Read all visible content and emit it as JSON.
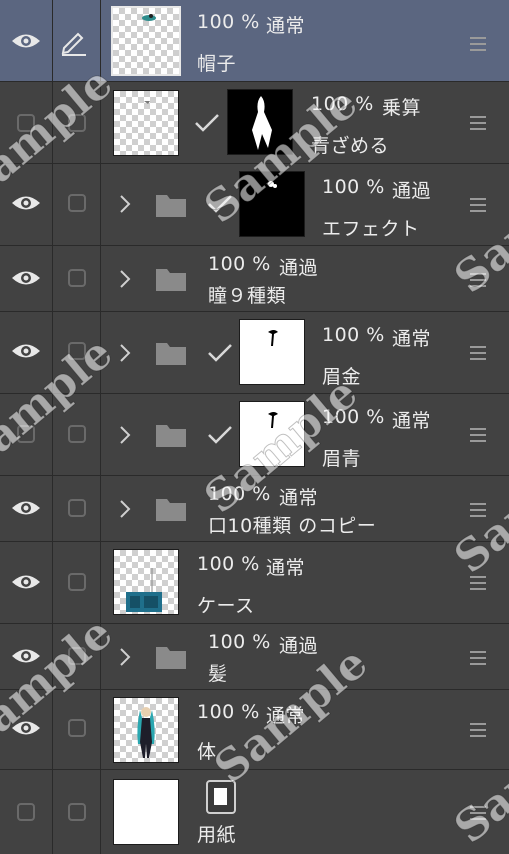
{
  "layers": [
    {
      "id": "hat",
      "opacity": "100 %",
      "blend": "通常",
      "name": "帽子",
      "visible": true,
      "selected": true
    },
    {
      "id": "aozameru",
      "opacity": "100 %",
      "blend": "乗算",
      "name": "青ざめる",
      "visible": false
    },
    {
      "id": "effect",
      "opacity": "100 %",
      "blend": "通過",
      "name": "エフェクト",
      "visible": true
    },
    {
      "id": "eyes",
      "opacity": "100 %",
      "blend": "通過",
      "name": "瞳９種類",
      "visible": true
    },
    {
      "id": "mayu-kin",
      "opacity": "100 %",
      "blend": "通常",
      "name": "眉金",
      "visible": true
    },
    {
      "id": "mayu-ao",
      "opacity": "100 %",
      "blend": "通常",
      "name": "眉青",
      "visible": false
    },
    {
      "id": "mouth",
      "opacity": "100 %",
      "blend": "通常",
      "name": "口10種類 のコピー",
      "visible": true
    },
    {
      "id": "case",
      "opacity": "100 %",
      "blend": "通常",
      "name": "ケース",
      "visible": true
    },
    {
      "id": "hair",
      "opacity": "100 %",
      "blend": "通過",
      "name": "髪",
      "visible": true
    },
    {
      "id": "body",
      "opacity": "100 %",
      "blend": "通常",
      "name": "体",
      "visible": true
    },
    {
      "id": "paper",
      "name": "用紙",
      "visible": false
    }
  ],
  "watermark": "Sample",
  "colors": {
    "panel_bg": "#424242",
    "selected_bg": "#5b6680",
    "text": "#ececec"
  }
}
